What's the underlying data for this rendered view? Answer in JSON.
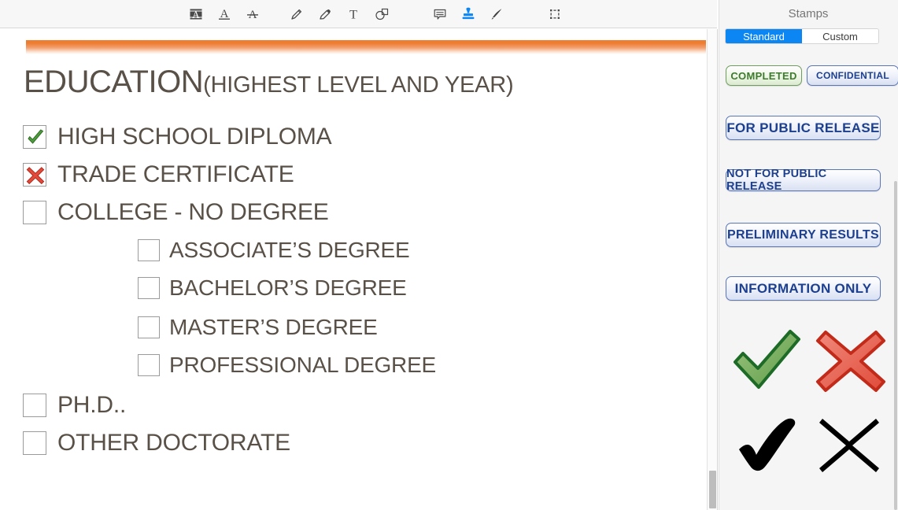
{
  "toolbar": {
    "tools": [
      {
        "name": "highlight-text-icon",
        "label": "Highlight Text",
        "active": false
      },
      {
        "name": "underline-text-icon",
        "label": "Underline Text",
        "active": false
      },
      {
        "name": "strikethrough-text-icon",
        "label": "Strikethrough Text",
        "active": false
      },
      {
        "name": "pencil-icon",
        "label": "Draw",
        "active": false
      },
      {
        "name": "eraser-icon",
        "label": "Erase",
        "active": false
      },
      {
        "name": "text-tool-icon",
        "label": "Add Text",
        "active": false
      },
      {
        "name": "shapes-icon",
        "label": "Shapes",
        "active": false
      },
      {
        "name": "comment-icon",
        "label": "Comment",
        "active": false
      },
      {
        "name": "stamp-icon",
        "label": "Stamp",
        "active": true
      },
      {
        "name": "signature-pen-icon",
        "label": "Signature",
        "active": false
      },
      {
        "name": "selection-marquee-icon",
        "label": "Select Area",
        "active": false
      }
    ],
    "accent_color": "#0b86f2"
  },
  "document": {
    "accent_bar_color": "#ED7D31",
    "title_main": "EDUCATION",
    "title_sub": "(HIGHEST LEVEL AND YEAR)",
    "title_color": "#595148",
    "items": [
      {
        "label": "HIGH SCHOOL DIPLOMA",
        "mark": "green-check",
        "indent": false
      },
      {
        "label": "TRADE CERTIFICATE",
        "mark": "red-x",
        "indent": false
      },
      {
        "label": "COLLEGE - NO DEGREE",
        "mark": "none",
        "indent": false
      },
      {
        "label": "ASSOCIATE’S DEGREE",
        "mark": "none",
        "indent": true
      },
      {
        "label": "BACHELOR’S DEGREE",
        "mark": "none",
        "indent": true
      },
      {
        "label": "MASTER’S DEGREE",
        "mark": "none",
        "indent": true
      },
      {
        "label": "PROFESSIONAL DEGREE",
        "mark": "none",
        "indent": true
      },
      {
        "label": "PH.D..",
        "mark": "none",
        "indent": false
      },
      {
        "label": "OTHER DOCTORATE",
        "mark": "none",
        "indent": false
      }
    ]
  },
  "panel": {
    "title": "Stamps",
    "tabs": [
      {
        "label": "Standard",
        "active": true
      },
      {
        "label": "Custom",
        "active": false
      }
    ],
    "text_stamps": [
      {
        "label": "COMPLETED",
        "style": "green"
      },
      {
        "label": "CONFIDENTIAL",
        "style": "blue"
      },
      {
        "label": "FOR PUBLIC RELEASE",
        "style": "blue"
      },
      {
        "label": "NOT FOR PUBLIC RELEASE",
        "style": "blue"
      },
      {
        "label": "PRELIMINARY RESULTS",
        "style": "blue"
      },
      {
        "label": "INFORMATION ONLY",
        "style": "blue"
      }
    ],
    "icon_stamps": [
      {
        "name": "green-check-stamp",
        "color": "#3a8a34"
      },
      {
        "name": "red-x-stamp",
        "color": "#d93025"
      },
      {
        "name": "black-check-stamp",
        "color": "#000000"
      },
      {
        "name": "black-x-stamp",
        "color": "#000000"
      }
    ]
  }
}
